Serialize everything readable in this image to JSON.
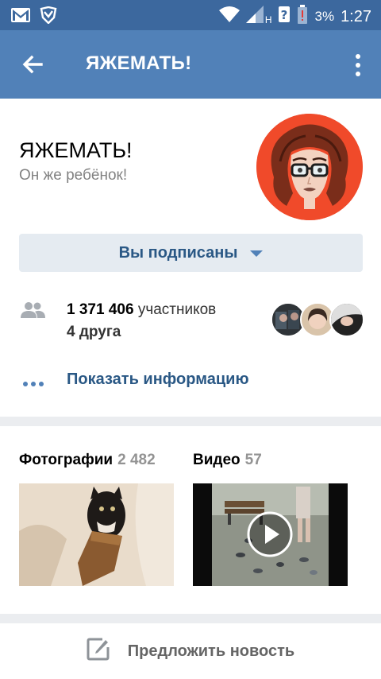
{
  "status_bar": {
    "network_label": "H",
    "battery_percent": "3%",
    "time": "1:27"
  },
  "toolbar": {
    "title": "ЯЖЕМАТЬ!"
  },
  "group": {
    "name": "ЯЖЕМАТЬ!",
    "status": "Он же ребёнок!",
    "subscribe_label": "Вы подписаны",
    "members_count": "1 371 406",
    "members_word": "участников",
    "friends": "4 друга",
    "show_info": "Показать информацию"
  },
  "media": {
    "photos_label": "Фотографии",
    "photos_count": "2 482",
    "videos_label": "Видео",
    "videos_count": "57"
  },
  "suggest": {
    "label": "Предложить новость"
  },
  "colors": {
    "status_bar": "#3c689e",
    "toolbar": "#5181b8",
    "link": "#2a5885",
    "avatar_bg": "#f04a2a"
  }
}
